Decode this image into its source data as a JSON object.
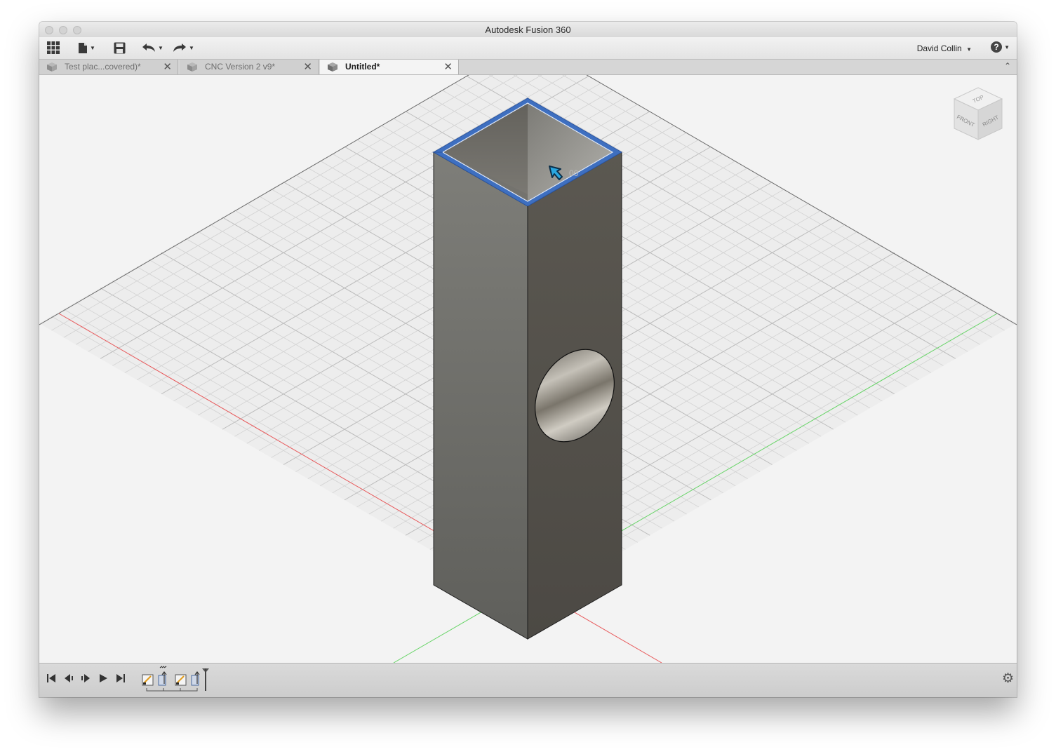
{
  "window": {
    "title": "Autodesk Fusion 360"
  },
  "toolbar": {
    "user_name": "David Collin",
    "help_label": "?",
    "icons": [
      "app-grid-icon",
      "file-icon",
      "save-icon",
      "undo-icon",
      "redo-icon"
    ]
  },
  "tabs": [
    {
      "label": "Test plac...covered)*",
      "close": "✕",
      "active": false
    },
    {
      "label": "CNC Version 2 v9*",
      "close": "✕",
      "active": false
    },
    {
      "label": "Untitled*",
      "close": "✕",
      "active": true
    }
  ],
  "viewcube": {
    "top": "TOP",
    "front": "FRONT",
    "right": "RIGHT"
  },
  "cursor": {
    "tooltip": "00"
  },
  "colors": {
    "x_axis": "#e8585a",
    "z_axis": "#66d466",
    "selection": "#3e6fc0",
    "body_left": "#7a7a76",
    "body_right": "#55524c"
  },
  "timeline": {
    "playback_controls": [
      "go-to-start",
      "step-back",
      "step-forward",
      "play",
      "go-to-end"
    ],
    "features": [
      "sketch",
      "extrude",
      "sketch",
      "extrude"
    ],
    "settings_icon": "gear-icon"
  }
}
